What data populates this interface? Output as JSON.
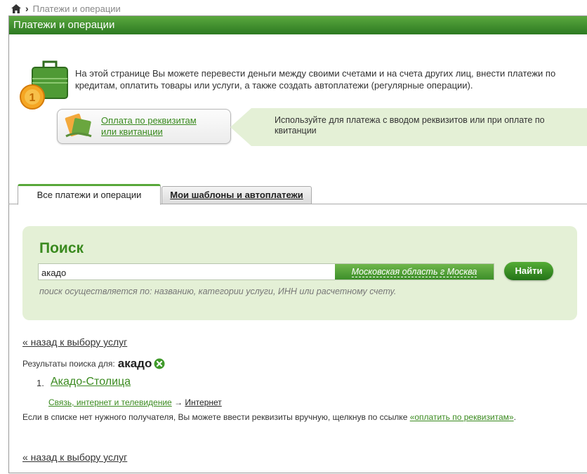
{
  "breadcrumb": {
    "home_icon": "home-icon",
    "separator": "›",
    "current": "Платежи и операции"
  },
  "titlebar": {
    "title": "Платежи и операции"
  },
  "intro": {
    "icon": "briefcase-coin-icon",
    "text": "На этой странице Вы можете перевести деньги между своими счетами и на счета других лиц, внести платежи по кредитам, оплатить товары или услуги, а также создать автоплатежи (регулярные операции)."
  },
  "pay_button": {
    "icon": "payment-card-icon",
    "line1": "Оплата по реквизитам",
    "line2": "или квитанции"
  },
  "hint": {
    "text": "Используйте для платежа с вводом реквизитов или при оплате по квитанции"
  },
  "tabs": [
    {
      "label": "Все платежи и операции",
      "active": true
    },
    {
      "label": "Мои шаблоны и автоплатежи",
      "active": false
    }
  ],
  "search": {
    "title": "Поиск",
    "value": "акадо",
    "region": "Московская область г Москва",
    "button": "Найти",
    "note": "поиск осуществляется по: названию, категории услуги, ИНН или расчетному счету."
  },
  "back_link": "« назад к выбору услуг",
  "results": {
    "label": "Результаты поиска для:",
    "query": "акадо",
    "clear_icon": "clear-x-icon",
    "items": [
      {
        "num": "1.",
        "name": "Акадо-Столица",
        "category": "Связь, интернет и телевидение",
        "arrow": "→",
        "subcategory": "Интернет"
      }
    ]
  },
  "manual_note": {
    "text": "Если в списке нет нужного получателя, Вы можете ввести реквизиты вручную, щелкнув по ссылке ",
    "link": "«оплатить по реквизитам»",
    "tail": "."
  },
  "colors": {
    "accent_green": "#3a8a1f",
    "panel_green": "#e4f0d6",
    "title_green": "#2d7a22"
  }
}
